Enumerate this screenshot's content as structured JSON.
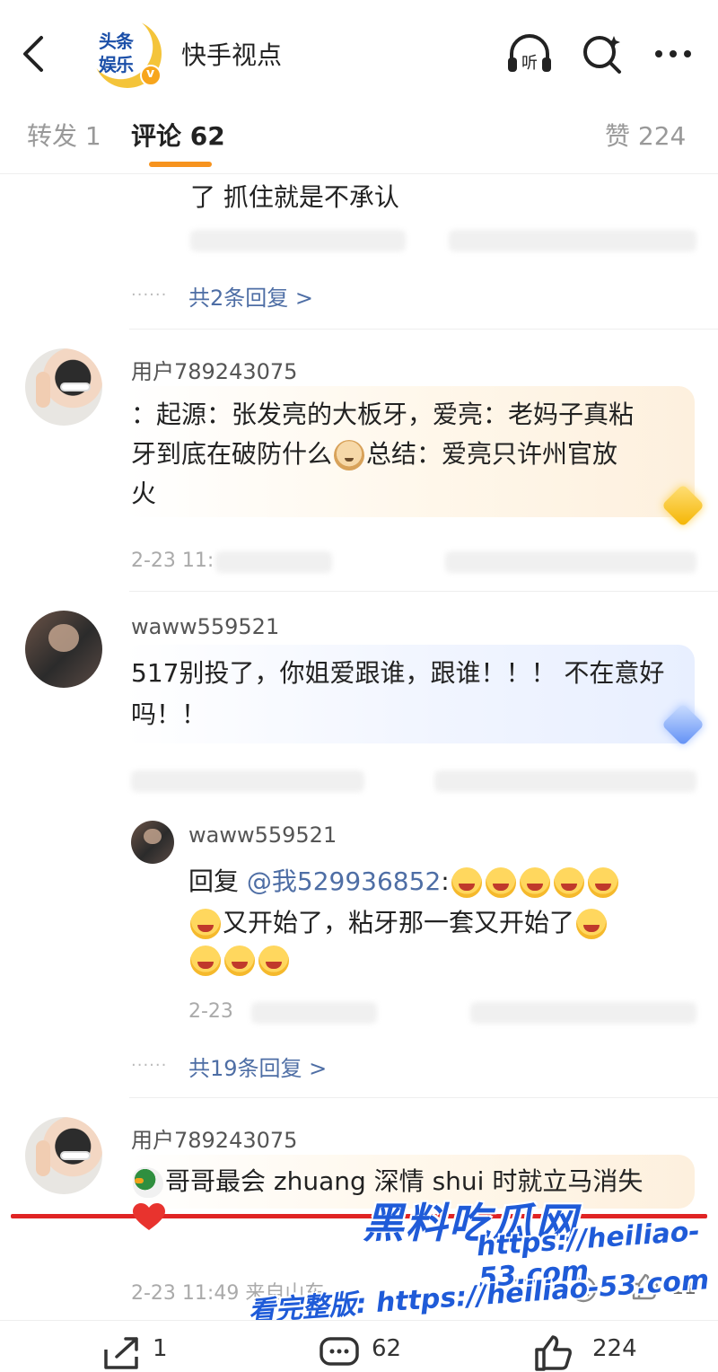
{
  "header": {
    "brand_line1": "头条",
    "brand_line2": "娱乐",
    "verified_mark": "v",
    "title": "快手视点",
    "listen_label": "听"
  },
  "tabs": {
    "repost": "转发 1",
    "comments": "评论 62",
    "likes": "赞 224"
  },
  "thread_top": {
    "text": "了 抓住就是不承认",
    "reply_count": "共2条回复 >"
  },
  "comments": [
    {
      "username": "用户789243075",
      "line1": "：起源：张发亮的大板牙，爱亮：老妈子真粘",
      "line2_a": "牙到底在破防什么",
      "line2_b": "总结：爱亮只许州官放",
      "line3": "火",
      "meta": "2-23 11:"
    },
    {
      "username": "waww559521",
      "line1": "517别投了，你姐爱跟谁，跟谁！！！ 不在意好",
      "line2": "吗！！",
      "reply": {
        "username": "waww559521",
        "prefix": "回复",
        "mention": "@我529936852",
        "suffix": ":",
        "line2": "又开始了，粘牙那一套又开始了",
        "meta": "2-23"
      },
      "reply_count": "共19条回复 >"
    },
    {
      "username": "用户789243075",
      "text": "哥哥最会 zhuang 深情 shui 时就立马消失",
      "meta": "2-23 11:49 来自山东",
      "like_count": "11"
    }
  ],
  "watermark": {
    "title": "黑料吃瓜网",
    "url": "https://heiliao-53.com",
    "bottom": "看完整版: https://heiliao-53.com"
  },
  "bottom_bar": {
    "repost_count": "1",
    "comment_count": "62",
    "like_count": "224"
  },
  "colors": {
    "accent": "#f7931e",
    "link": "#4e6ea5",
    "watermark": "#1f5bd8",
    "red_line": "#e02424"
  }
}
